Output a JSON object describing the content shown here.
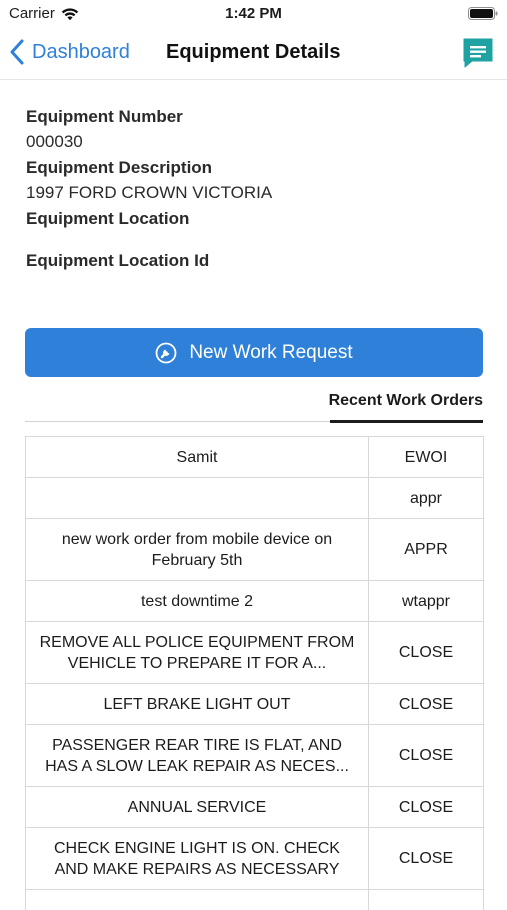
{
  "status_bar": {
    "carrier": "Carrier",
    "time": "1:42 PM",
    "icons": [
      "wifi-icon",
      "battery-icon"
    ]
  },
  "nav": {
    "back_label": "Dashboard",
    "title": "Equipment Details",
    "back_icon": "chevron-left-icon",
    "chat_icon": "message-icon",
    "accent_color": "#2f80d8",
    "chat_color": "#1fa2a2"
  },
  "equipment": {
    "number_label": "Equipment Number",
    "number_value": "000030",
    "description_label": "Equipment Description",
    "description_value": "1997 FORD CROWN VICTORIA",
    "location_label": "Equipment Location",
    "location_value": "",
    "location_id_label": "Equipment Location Id",
    "location_id_value": ""
  },
  "actions": {
    "new_work_request_label": "New Work Request",
    "new_work_request_icon": "wrench-icon",
    "button_color": "#2f80d8"
  },
  "tabs": {
    "recent_work_orders_label": "Recent Work Orders"
  },
  "work_orders": [
    {
      "description": "Samit",
      "status": "EWOI"
    },
    {
      "description": "",
      "status": "appr"
    },
    {
      "description": "new work order from mobile device on February 5th",
      "status": "APPR"
    },
    {
      "description": "test downtime 2",
      "status": "wtappr"
    },
    {
      "description": "REMOVE ALL POLICE EQUIPMENT FROM VEHICLE TO PREPARE IT FOR A...",
      "status": "CLOSE"
    },
    {
      "description": "LEFT BRAKE LIGHT OUT",
      "status": "CLOSE"
    },
    {
      "description": "PASSENGER REAR TIRE IS FLAT, AND HAS A SLOW LEAK REPAIR AS NECES...",
      "status": "CLOSE"
    },
    {
      "description": "ANNUAL SERVICE",
      "status": "CLOSE"
    },
    {
      "description": "CHECK ENGINE LIGHT IS ON. CHECK AND MAKE REPAIRS AS NECESSARY",
      "status": "CLOSE"
    },
    {
      "description": "",
      "status": ""
    }
  ]
}
